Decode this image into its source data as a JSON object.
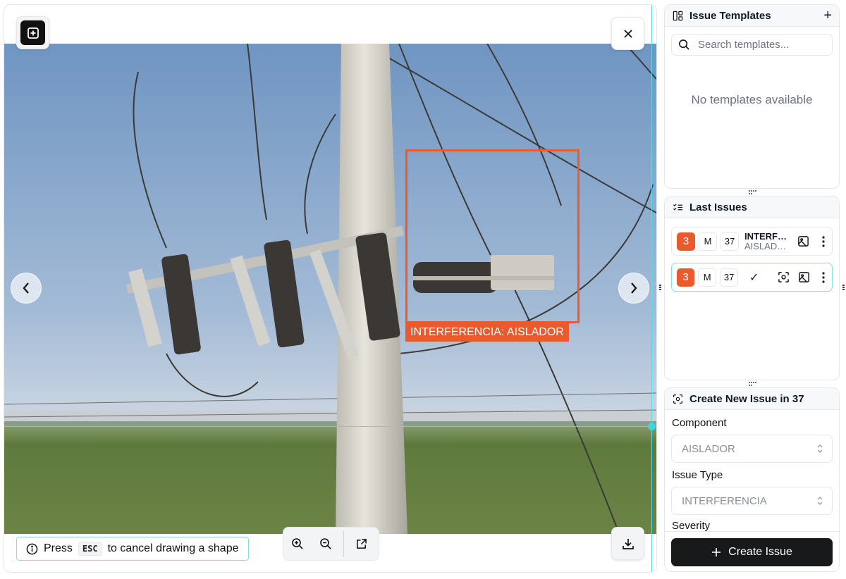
{
  "viewer": {
    "bbox_label": "INTERFERENCIA: AISLADOR",
    "hint": {
      "prefix": "Press",
      "key": "ESC",
      "suffix": "to cancel drawing a shape"
    },
    "icons": {
      "draw": "add-shape-icon",
      "close": "close-icon",
      "prev": "chevron-left-icon",
      "next": "chevron-right-icon",
      "zoom_in": "zoom-in-icon",
      "zoom_out": "zoom-out-icon",
      "fit": "expand-icon",
      "download": "download-icon",
      "info": "info-icon"
    },
    "colors": {
      "bbox": "#ea5a2c",
      "guide": "#5ad8e3"
    }
  },
  "templates": {
    "title": "Issue Templates",
    "add_label": "+",
    "search_placeholder": "Search templates...",
    "empty_text": "No templates available"
  },
  "last_issues": {
    "title": "Last Issues",
    "items": [
      {
        "severity": "3",
        "size": "M",
        "number": "37",
        "title": "INTERFERENCIA",
        "subtitle": "AISLADOR"
      },
      {
        "severity": "3",
        "size": "M",
        "number": "37",
        "status": "✓"
      }
    ]
  },
  "create": {
    "title": "Create New Issue in 37",
    "component_label": "Component",
    "component_value": "AISLADOR",
    "issue_type_label": "Issue Type",
    "issue_type_value": "INTERFERENCIA",
    "severity_label": "Severity",
    "button_label": "Create Issue"
  }
}
